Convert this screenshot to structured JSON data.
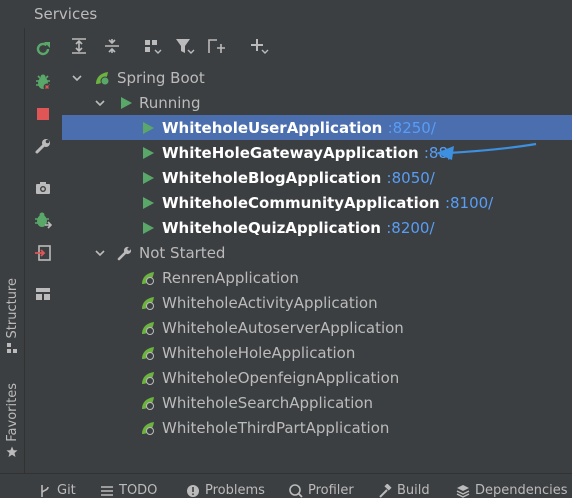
{
  "panel": {
    "title": "Services"
  },
  "left_tabs": [
    {
      "label": "Structure"
    },
    {
      "label": "Favorites"
    }
  ],
  "action_buttons": [
    {
      "icon": "rerun-icon"
    },
    {
      "icon": "debug-icon"
    },
    {
      "icon": "stop-icon"
    },
    {
      "icon": "wrench-icon"
    },
    {
      "icon": "camera-icon"
    },
    {
      "icon": "debug-attach-icon"
    },
    {
      "icon": "exit-icon"
    },
    {
      "icon": "layout-icon"
    }
  ],
  "toolbar": [
    {
      "icon": "expand-all-icon"
    },
    {
      "icon": "collapse-all-icon"
    },
    {
      "icon": "group-by-icon"
    },
    {
      "icon": "filter-icon"
    },
    {
      "icon": "new-tab-icon"
    },
    {
      "icon": "add-icon"
    }
  ],
  "tree": {
    "root": {
      "label": "Spring Boot"
    },
    "running": {
      "label": "Running",
      "apps": [
        {
          "name": "WhiteholeUserApplication",
          "port": ":8250/",
          "selected": true
        },
        {
          "name": "WhiteHoleGatewayApplication",
          "port": ":88/",
          "selected": false
        },
        {
          "name": "WhiteholeBlogApplication",
          "port": ":8050/",
          "selected": false
        },
        {
          "name": "WhiteholeCommunityApplication",
          "port": ":8100/",
          "selected": false
        },
        {
          "name": "WhiteholeQuizApplication",
          "port": ":8200/",
          "selected": false
        }
      ]
    },
    "not_started": {
      "label": "Not Started",
      "apps": [
        {
          "name": "RenrenApplication"
        },
        {
          "name": "WhiteholeActivityApplication"
        },
        {
          "name": "WhiteholeAutoserverApplication"
        },
        {
          "name": "WhiteholeHoleApplication"
        },
        {
          "name": "WhiteholeOpenfeignApplication"
        },
        {
          "name": "WhiteholeSearchApplication"
        },
        {
          "name": "WhiteholeThirdPartApplication"
        }
      ]
    }
  },
  "bottom_tabs": [
    {
      "label": "Git"
    },
    {
      "label": "TODO"
    },
    {
      "label": "Problems"
    },
    {
      "label": "Profiler"
    },
    {
      "label": "Build"
    },
    {
      "label": "Dependencies"
    }
  ],
  "colors": {
    "selection": "#4b6eaf",
    "run_green": "#59a869",
    "port_blue": "#589df6",
    "annotation_arrow": "#3d8fe0"
  }
}
